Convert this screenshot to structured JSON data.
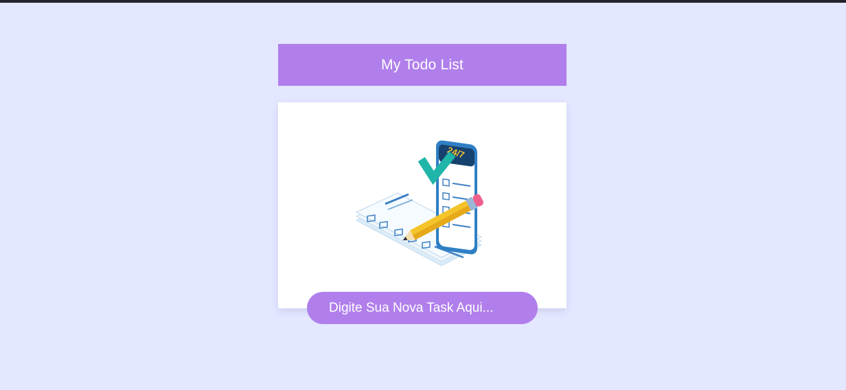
{
  "header": {
    "title": "My Todo List"
  },
  "illustration": {
    "phone_badge": "24/7",
    "icon": "todo-checklist-illustration-icon"
  },
  "task_input": {
    "placeholder": "Digite Sua Nova Task Aqui...",
    "value": ""
  },
  "colors": {
    "background": "#e3e7ff",
    "accent": "#b07feb",
    "top_bar": "#23232e",
    "card": "#ffffff"
  }
}
